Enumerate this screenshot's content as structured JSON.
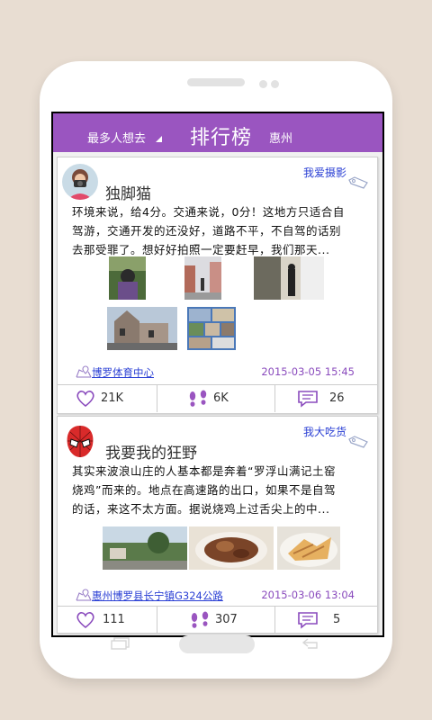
{
  "header": {
    "left_label": "最多人想去",
    "title": "排行榜",
    "city": "惠州"
  },
  "posts": [
    {
      "username": "独脚猫",
      "tag": "我爱摄影",
      "text_lines": [
        "环境来说，给4分。交通来说，0分！这地方只适合自",
        "驾游，交通开发的还没好，道路不平，不自驾的话别",
        "去那受罪了。想好好拍照一定要赶早，我们那天..."
      ],
      "location": "博罗体育中心",
      "time": "2015-03-05  15:45",
      "likes": "21K",
      "visits": "6K",
      "comments": "26"
    },
    {
      "username": "我要我的狂野",
      "tag": "我大吃货",
      "text_lines": [
        "其实来波浪山庄的人基本都是奔着“罗浮山满记土窑",
        "烧鸡”而来的。地点在高速路的出口，如果不是自驾",
        "的话，来这不太方面。据说烧鸡上过舌尖上的中..."
      ],
      "location": "惠州博罗县长宁镇G324公路",
      "time": "2015-03-06  13:04",
      "likes": "111",
      "visits": "307",
      "comments": "5"
    }
  ],
  "colors": {
    "accent": "#9a55c0",
    "link": "#2a3fd4",
    "time": "#8a4bbd"
  },
  "icons": {
    "like": "heart-icon",
    "visit": "footprints-icon",
    "comment": "comment-icon",
    "tag": "price-tag-icon",
    "location": "map-pin-icon"
  }
}
